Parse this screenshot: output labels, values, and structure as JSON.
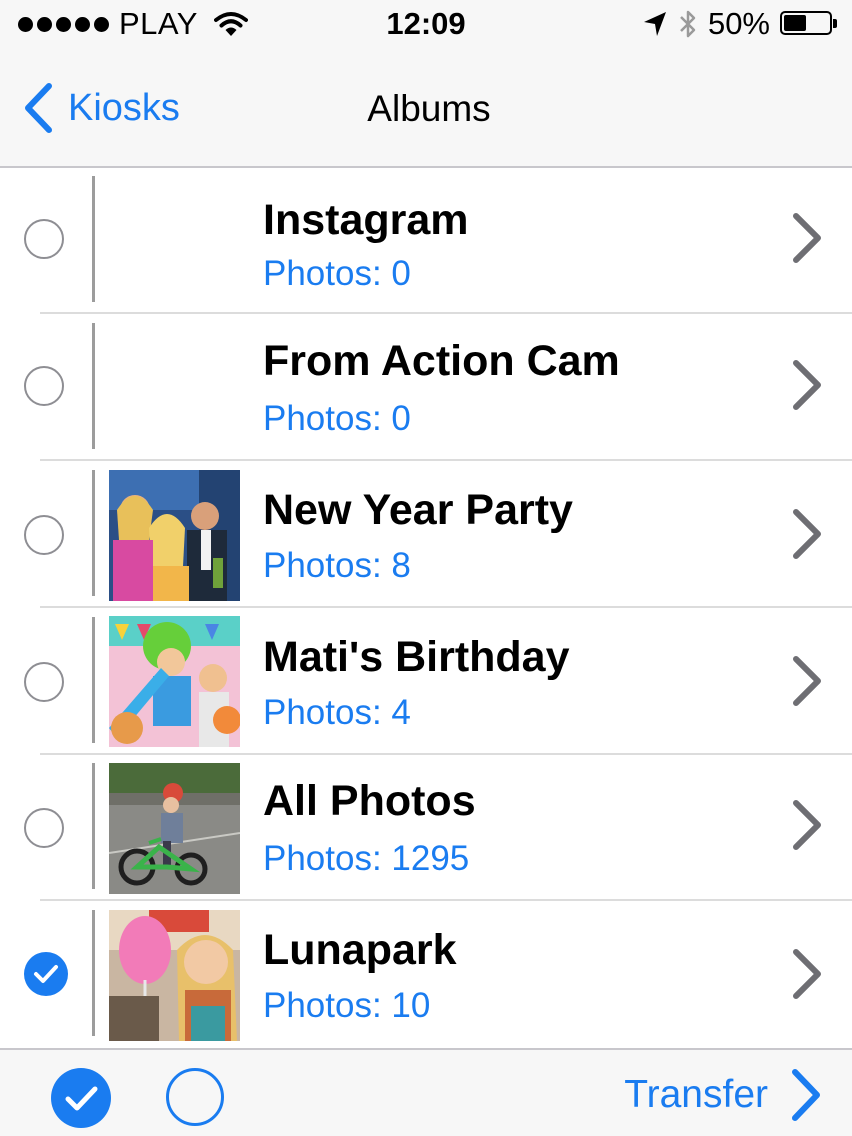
{
  "status_bar": {
    "carrier": "PLAY",
    "time": "12:09",
    "battery": "50%",
    "battery_level": 0.5,
    "signal_dots": 5
  },
  "nav": {
    "back_label": "Kiosks",
    "title": "Albums"
  },
  "albums": [
    {
      "title": "Instagram",
      "subtitle": "Photos: 0",
      "selected": false,
      "thumbnail": "none"
    },
    {
      "title": "From Action Cam",
      "subtitle": "Photos: 0",
      "selected": false,
      "thumbnail": "none"
    },
    {
      "title": "New Year Party",
      "subtitle": "Photos: 8",
      "selected": false,
      "thumbnail": "party-photo"
    },
    {
      "title": "Mati's Birthday",
      "subtitle": "Photos: 4",
      "selected": false,
      "thumbnail": "birthday-photo"
    },
    {
      "title": "All Photos",
      "subtitle": "Photos: 1295",
      "selected": false,
      "thumbnail": "bike-photo"
    },
    {
      "title": "Lunapark",
      "subtitle": "Photos: 10",
      "selected": true,
      "thumbnail": "cotton-candy-photo"
    }
  ],
  "toolbar": {
    "transfer_label": "Transfer"
  },
  "colors": {
    "accent": "#1a7cf0",
    "bar_background": "#f7f7f7",
    "separator": "#dcdcdc"
  }
}
